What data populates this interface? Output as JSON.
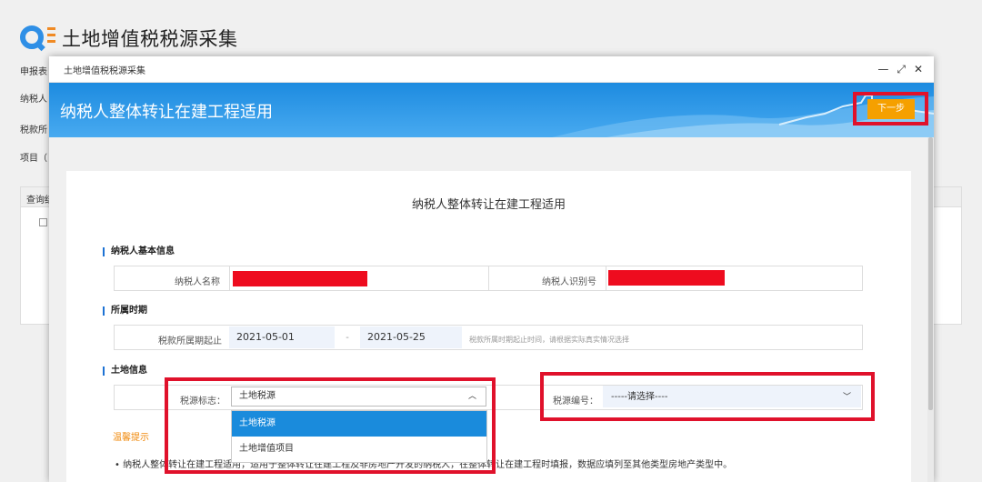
{
  "background": {
    "title": "土地增值税税源采集",
    "labels": [
      "申报表",
      "纳税人",
      "税款所",
      "项目（"
    ],
    "panel_label": "查询结"
  },
  "modal": {
    "title": "土地增值税税源采集",
    "controls": {
      "minimize": "—",
      "maximize": "⤢",
      "close": "✕"
    },
    "banner_title": "纳税人整体转让在建工程适用",
    "next_button": "下一步",
    "card_title": "纳税人整体转让在建工程适用",
    "sections": {
      "basic": {
        "title": "纳税人基本信息",
        "name_label": "纳税人名称",
        "id_label": "纳税人识别号"
      },
      "period": {
        "title": "所属时期",
        "start_label": "税款所属期起止",
        "start_date": "2021-05-01",
        "separator": "-",
        "end_date": "2021-05-25",
        "hint": "税款所属时期起止时间，请根据实际真实情况选择"
      },
      "land": {
        "title": "土地信息",
        "source_flag_label": "税源标志：",
        "source_flag_value": "土地税源",
        "source_no_label": "税源编号：",
        "source_no_value": "-----请选择----",
        "options": [
          "土地税源",
          "土地增值项目"
        ]
      }
    },
    "tips": {
      "title": "温馨提示",
      "text": "•  纳税人整体转让在建工程适用，适用于整体转让在建工程及非房地产开发的纳税人，在整体转让在建工程时填报，数据应填列至其他类型房地产类型中。"
    }
  },
  "colors": {
    "banner": "#1d8be0",
    "accent_button": "#f5a000",
    "highlight_box": "#e0112b",
    "selected_option": "#1a8bdc",
    "tip_title": "#f0880a"
  }
}
